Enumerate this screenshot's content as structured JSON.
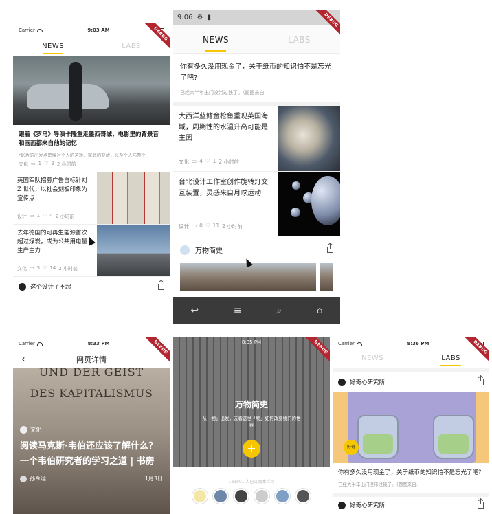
{
  "s1": {
    "carrier": "Carrier",
    "time": "9:03 AM",
    "tabs": [
      "NEWS",
      "LABS"
    ],
    "feature_title": "跟着《罗马》导演卡隆重走墨西哥城，电影里的背景音和画面都来自他的记忆",
    "feature_desc": "*影片的出发点是探讨个人的苦难、家庭的变故，以及个人与整个",
    "feature_meta": [
      "文化",
      "1",
      "9",
      "2 小时前"
    ],
    "items": [
      {
        "title": "英国军队招募广告自标针对 Z 世代，以社会刻板印象为宣传点",
        "meta": [
          "设计",
          "1",
          "4",
          "2 小时前"
        ]
      },
      {
        "title": "去年德国的可再生能源首次超过煤炭，成为公共用电量生产主力",
        "meta": [
          "文化",
          "5",
          "14",
          "2 小时前"
        ]
      }
    ],
    "labs_title": "这个设计了不起"
  },
  "s2": {
    "time": "9:06",
    "tabs": [
      "NEWS",
      "LABS"
    ],
    "top_title": "你有多久没用现金了，关于纸币的知识怕不是忘光了吧?",
    "top_desc": "已经大半年出门没带过钱了。（题图来自:",
    "items": [
      {
        "title": "大西洋蓝鳍金枪鱼重现英国海域，周期性的水温升高可能是主因",
        "meta": [
          "文化",
          "4",
          "1",
          "2 小时前"
        ]
      },
      {
        "title": "台北设计工作室创作旋转灯交互装置，灵感来自月球运动",
        "meta": [
          "设计",
          "0",
          "11",
          "2 小时前"
        ]
      }
    ],
    "section_title": "万物简史"
  },
  "s3": {
    "carrier": "Carrier",
    "time": "8:33 PM",
    "nav_title": "网页详情",
    "book_text_1": "UND DER GEIST",
    "book_text_2": "DES KAPITALISMUS",
    "category": "文化",
    "title": "阅读马克斯·韦伯还应该了解什么？一个韦伯研究者的学习之道 | 书房",
    "author": "孙今迳",
    "date": "1月3日"
  },
  "s4": {
    "time": "8:35 PM",
    "hero_title": "万物简史",
    "hero_sub": "从「物」出发，去看这世「物」如何改变我们的世界",
    "joined": "133801 人已订阅本栏目",
    "fab": "+"
  },
  "s5": {
    "carrier": "Carrier",
    "time": "8:36 PM",
    "tabs": [
      "NEWS",
      "LABS"
    ],
    "channel": "好奇心研究所",
    "badge": "好奇",
    "article_title": "你有多久没用现金了，关于纸币的知识怕不是忘光了吧?",
    "article_desc": "已经大半年出门没带过钱了。（题图来自:",
    "channel2": "好奇心研究所"
  },
  "debug_label": "DEBUG",
  "colors": {
    "accent": "#f6c700",
    "debug": "#b3262f"
  }
}
